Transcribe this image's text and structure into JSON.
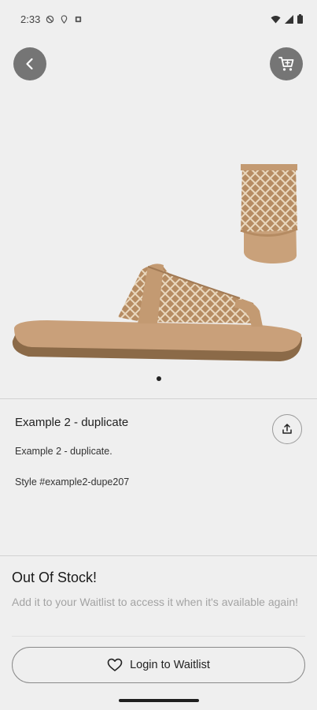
{
  "status_bar": {
    "time": "2:33",
    "left_icons": [
      "do-not-disturb-icon",
      "location-icon",
      "notification-icon"
    ],
    "right_icons": [
      "wifi-icon",
      "signal-icon",
      "battery-icon"
    ]
  },
  "header": {
    "back_icon": "chevron-left-icon",
    "cart_icon": "cart-icon",
    "button_color": "#757575"
  },
  "gallery": {
    "image_count": 1,
    "active_index": 0,
    "product_color": "#c39a72"
  },
  "product": {
    "title": "Example 2 - duplicate",
    "description": "Example 2 - duplicate.",
    "style": "Style #example2-dupe207",
    "share_icon": "share-icon"
  },
  "stock": {
    "title": "Out Of Stock!",
    "message": "Add it to your Waitlist to access it when it's available again!",
    "button_label": "Login to Waitlist",
    "button_icon": "heart-icon"
  }
}
